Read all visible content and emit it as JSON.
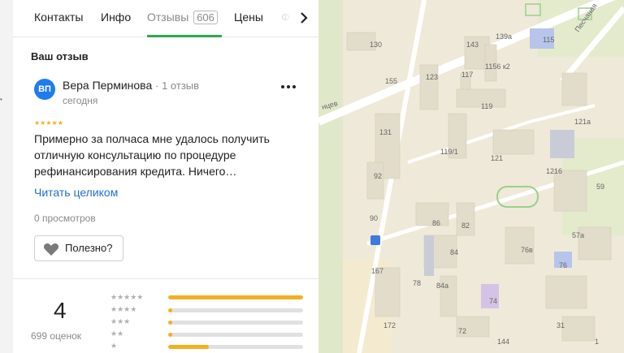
{
  "tabs": [
    {
      "label": "Контакты"
    },
    {
      "label": "Инфо"
    },
    {
      "label": "Отзывы",
      "count": "606"
    },
    {
      "label": "Цены"
    },
    {
      "label": "Ф"
    }
  ],
  "review": {
    "section_title": "Ваш отзыв",
    "avatar_initials": "ВП",
    "author": "Вера Перминова",
    "author_meta": "· 1 отзыв",
    "date": "сегодня",
    "stars": "★★★★★",
    "text": "Примерно за полчаса мне удалось получить отличную консультацию по процедуре рефинансирования кредита. Ничего…",
    "read_more": "Читать целиком",
    "views": "0 просмотров",
    "useful_label": "Полезно?"
  },
  "rating": {
    "value": "4",
    "count_label": "699 оценок",
    "rows": [
      {
        "stars": "★★★★★",
        "fraction": 1.0
      },
      {
        "stars": "★★★★",
        "fraction": 0.03
      },
      {
        "stars": "★★★",
        "fraction": 0.03
      },
      {
        "stars": "★★",
        "fraction": 0.03
      },
      {
        "stars": "★",
        "fraction": 0.3
      }
    ]
  },
  "map": {
    "street_labels": [
      "Песчаная",
      "нцев"
    ],
    "building_numbers": [
      "130",
      "143",
      "139а",
      "115",
      "1156 к2",
      "123",
      "117",
      "155",
      "119",
      "121а",
      "131",
      "119/1",
      "121",
      "1216",
      "92",
      "59",
      "90",
      "86",
      "82",
      "57а",
      "167",
      "84",
      "76в",
      "76",
      "78",
      "84а",
      "74",
      "172",
      "72",
      "144",
      "31",
      "1"
    ]
  },
  "colors": {
    "accent_green": "#2fa84f",
    "star_yellow": "#f2b01e",
    "link_blue": "#1f6fd1",
    "avatar_blue": "#1f7cf0"
  }
}
